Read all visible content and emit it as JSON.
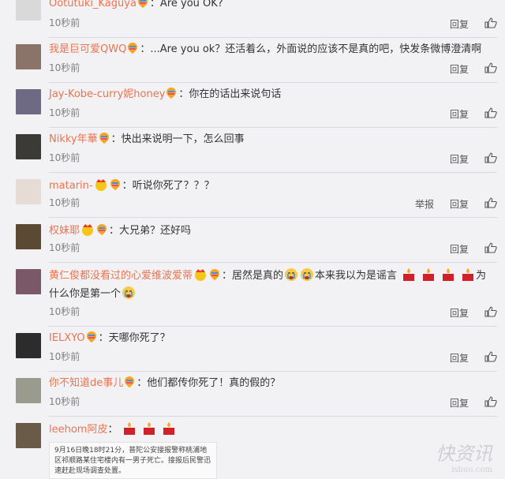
{
  "comments": [
    {
      "name": "Ootutuki_Kaguya",
      "text": "：Are you OK?",
      "time": "10秒前",
      "reply": "回复",
      "avatar_color": "#d9d9d9",
      "crown": false
    },
    {
      "name": "我是巨可爱QWQ",
      "text": "：...Are you ok？还活着么，外面说的应该不是真的吧，快发条微博澄清啊",
      "time": "10秒前",
      "reply": "回复",
      "avatar_color": "#8a7368",
      "crown": false
    },
    {
      "name": "Jay-Kobe-curry妮honey",
      "text": "：你在的话出来说句话",
      "time": "10秒前",
      "reply": "回复",
      "avatar_color": "#6f6a84",
      "crown": false
    },
    {
      "name": "Nikky年華",
      "text": "：快出来说明一下，怎么回事",
      "time": "10秒前",
      "reply": "回复",
      "avatar_color": "#3c3a36",
      "crown": false
    },
    {
      "name": "matarin-",
      "text": "：听说你死了？？？",
      "time": "10秒前",
      "report": "举报",
      "reply": "回复",
      "avatar_color": "#e6dcd6",
      "crown": true
    },
    {
      "name": "权妹耶",
      "text": "：大兄弟？还好吗",
      "time": "10秒前",
      "reply": "回复",
      "avatar_color": "#5a4a33",
      "crown": true
    },
    {
      "name": "黄仁俊都没看过的心爱维波爱蒂",
      "text_a": "：居然是真的",
      "text_b": "本来我以为是谣言",
      "text_c": "为",
      "text_d": "什么你是第一个",
      "time": "10秒前",
      "reply": "回复",
      "avatar_color": "#7a5868",
      "crown": true
    },
    {
      "name": "IELXYO",
      "text": "：天哪你死了？",
      "time": "10秒前",
      "reply": "回复",
      "avatar_color": "#2c2c2c",
      "crown": false
    },
    {
      "name": "你不知道de事儿",
      "text": "：他们都传你死了！真的假的？",
      "time": "10秒前",
      "reply": "回复",
      "avatar_color": "#9a9a8e",
      "crown": false
    },
    {
      "name": "leehom阿皮",
      "text": "：",
      "avatar_color": "#6a5a48",
      "crown": false
    }
  ],
  "news_snippet": "9月16日晚18时21分，普陀公安接报警称桃浦地区祁顺路某住宅楼内有一男子死亡。接报后民警迅速赶赴现场调查处置。",
  "watermark": "快资讯",
  "watermark_sub": "isbuu.com",
  "colors": {
    "name": "#eb7350",
    "text": "#333333",
    "time": "#808080",
    "bg": "#f2f2f5"
  }
}
